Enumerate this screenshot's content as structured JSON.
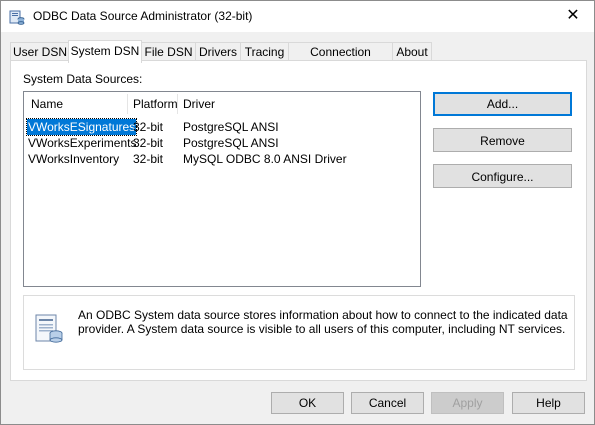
{
  "window": {
    "title": "ODBC Data Source Administrator (32-bit)",
    "close_glyph": "✕"
  },
  "tabs": [
    {
      "label": "User DSN",
      "active": false
    },
    {
      "label": "System DSN",
      "active": true
    },
    {
      "label": "File DSN",
      "active": false
    },
    {
      "label": "Drivers",
      "active": false
    },
    {
      "label": "Tracing",
      "active": false
    },
    {
      "label": "Connection Pooling",
      "active": false
    },
    {
      "label": "About",
      "active": false
    }
  ],
  "panel": {
    "section_label": "System Data Sources:",
    "columns": [
      "Name",
      "Platform",
      "Driver"
    ],
    "rows": [
      {
        "name": "VWorksESignatures",
        "platform": "32-bit",
        "driver": "PostgreSQL ANSI",
        "selected": true
      },
      {
        "name": "VWorksExperiments",
        "platform": "32-bit",
        "driver": "PostgreSQL ANSI",
        "selected": false
      },
      {
        "name": "VWorksInventory",
        "platform": "32-bit",
        "driver": "MySQL ODBC 8.0 ANSI Driver",
        "selected": false
      }
    ],
    "buttons": {
      "add": "Add...",
      "remove": "Remove",
      "configure": "Configure..."
    },
    "info_text": "An ODBC System data source stores information about how to connect to the indicated data provider. A System data source is visible to all users of this computer, including NT services."
  },
  "footer": {
    "ok": "OK",
    "cancel": "Cancel",
    "apply": "Apply",
    "help": "Help"
  },
  "colors": {
    "selection": "#0078d7",
    "default_button_border": "#0078d7"
  }
}
